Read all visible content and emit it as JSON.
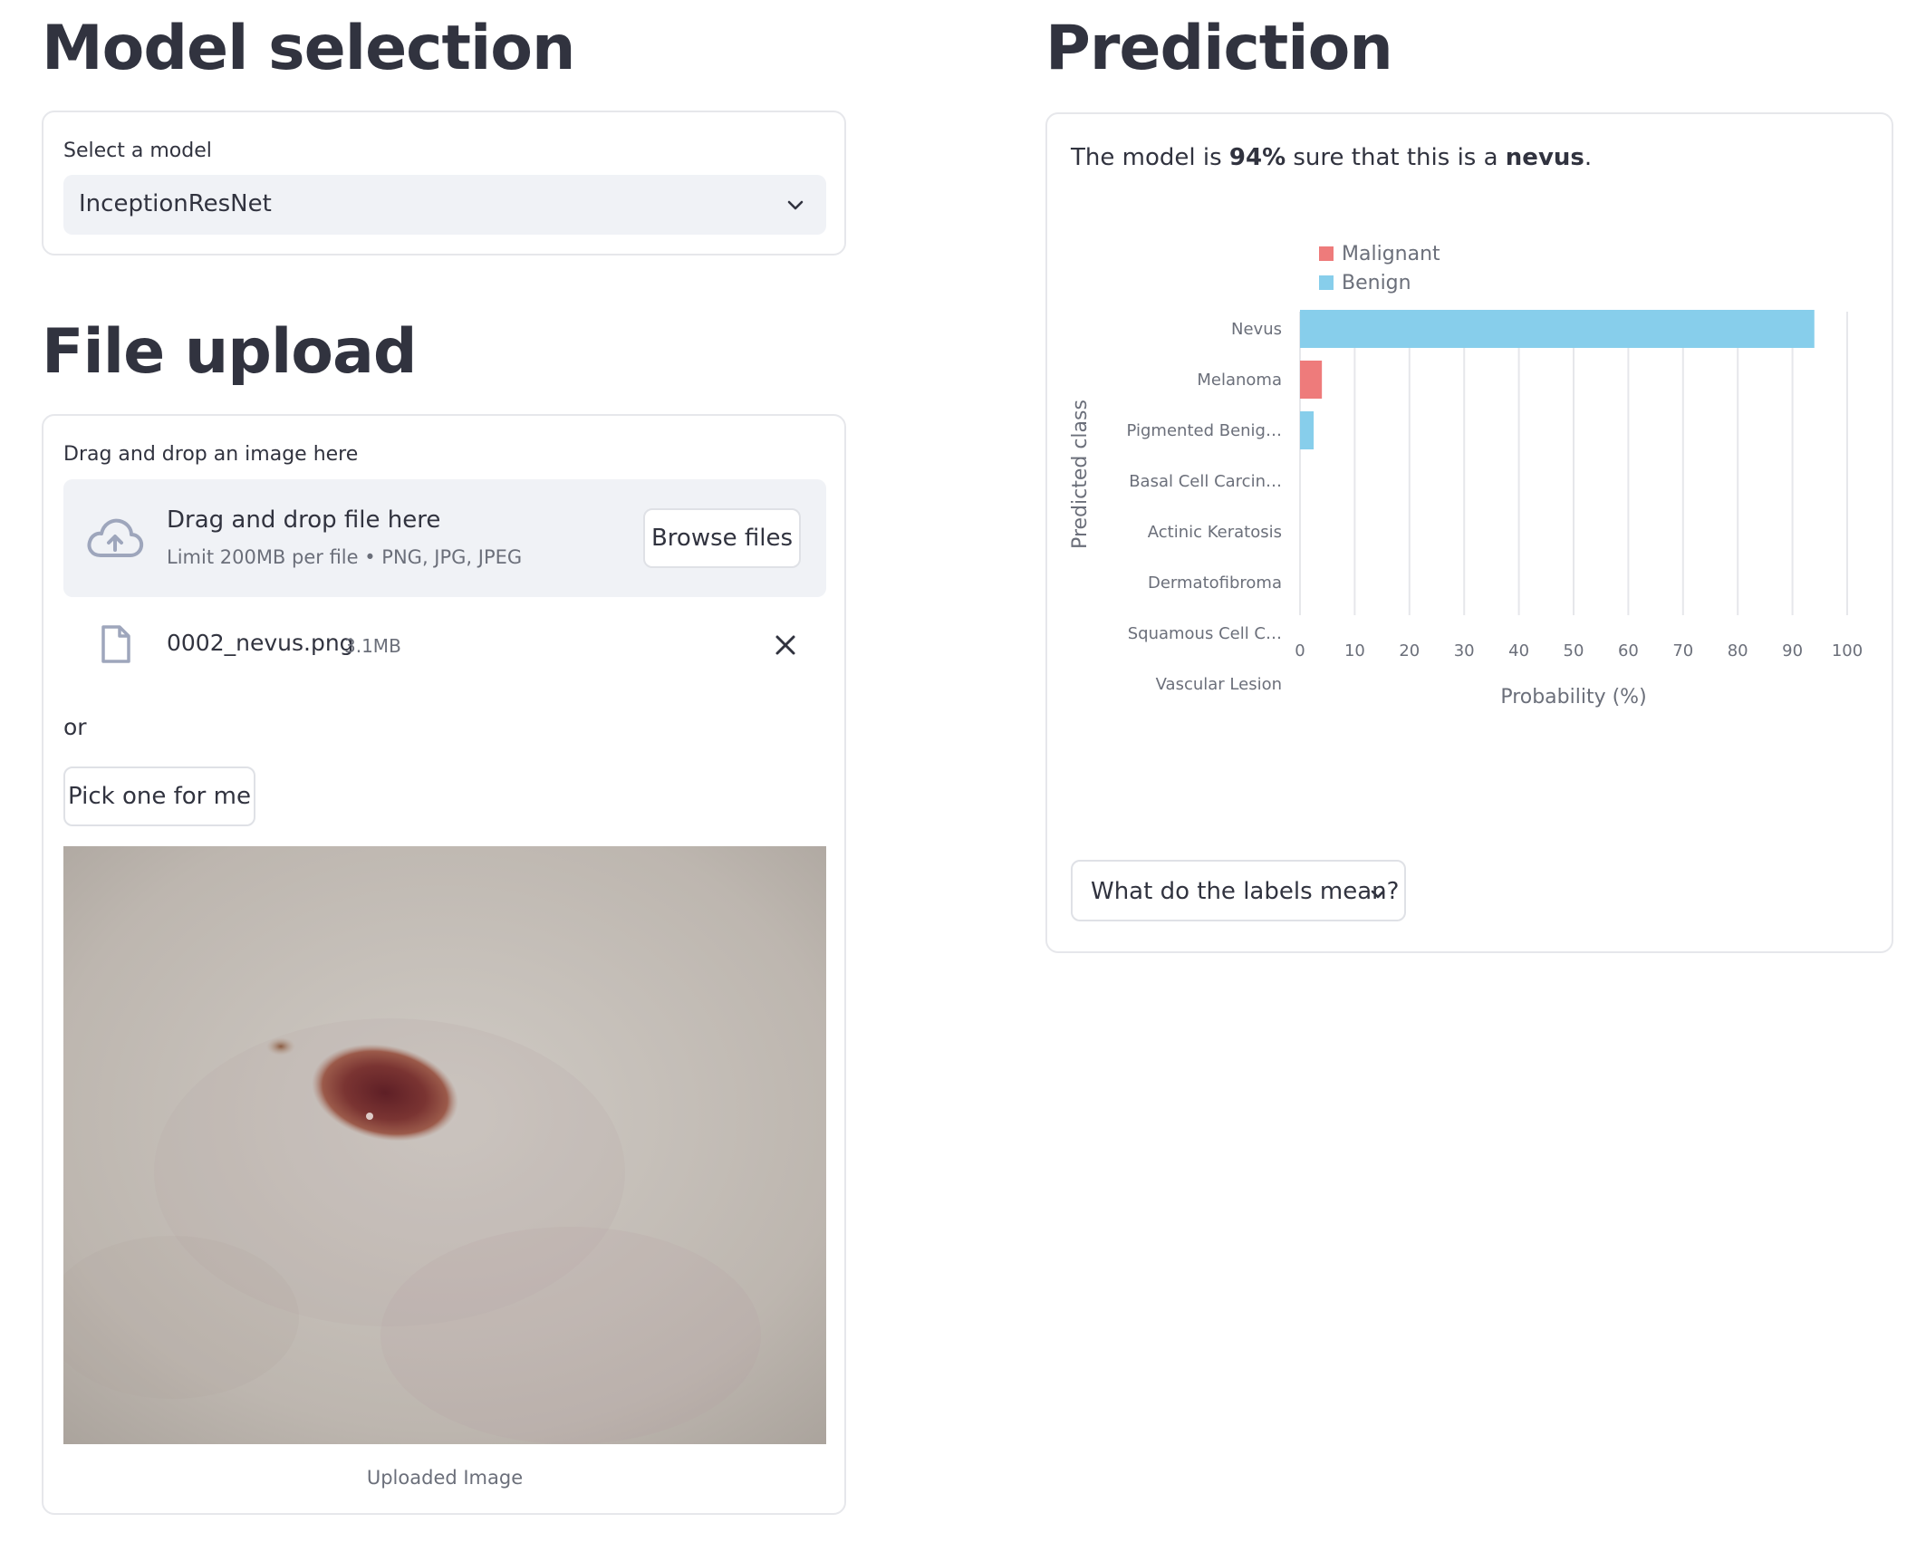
{
  "model_section": {
    "heading": "Model selection",
    "select_label": "Select a model",
    "selected_model": "InceptionResNet"
  },
  "upload_section": {
    "heading": "File upload",
    "dropzone_label": "Drag and drop an image here",
    "dropzone_title": "Drag and drop file here",
    "dropzone_limit": "Limit 200MB per file • PNG, JPG, JPEG",
    "browse_button": "Browse files",
    "file": {
      "name": "0002_nevus.png",
      "size": "3.1MB"
    },
    "or_text": "or",
    "pick_button": "Pick one for me",
    "image_caption": "Uploaded Image"
  },
  "prediction_section": {
    "heading": "Prediction",
    "sentence_prefix": "The model is ",
    "confidence": "94%",
    "sentence_middle": " sure that this is a ",
    "predicted_label": "nevus",
    "sentence_suffix": ".",
    "expander_label": "What do the labels mean?"
  },
  "chart_data": {
    "type": "bar",
    "orientation": "horizontal",
    "categories": [
      "Nevus",
      "Melanoma",
      "Pigmented Benig…",
      "Basal Cell Carcin…",
      "Actinic Keratosis",
      "Dermatofibroma",
      "Squamous Cell C…",
      "Vascular Lesion"
    ],
    "values": [
      94,
      4,
      2.5,
      0,
      0,
      0,
      0,
      0
    ],
    "bar_types": [
      "Benign",
      "Malignant",
      "Benign",
      "Malignant",
      "Malignant",
      "Benign",
      "Malignant",
      "Benign"
    ],
    "legend": [
      {
        "name": "Malignant",
        "color": "#ee7b7b"
      },
      {
        "name": "Benign",
        "color": "#87ceeb"
      }
    ],
    "xlabel": "Probability (%)",
    "ylabel": "Predicted class",
    "xlim": [
      0,
      100
    ],
    "xticks": [
      0,
      10,
      20,
      30,
      40,
      50,
      60,
      70,
      80,
      90,
      100
    ],
    "grid": true,
    "legend_position": "top-left"
  }
}
